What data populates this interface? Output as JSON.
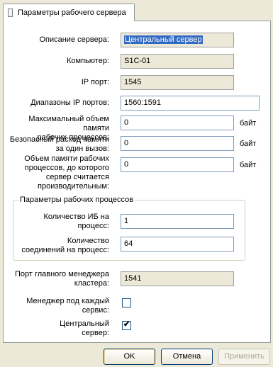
{
  "tab": {
    "label": "Параметры рабочего сервера"
  },
  "fields": {
    "description": {
      "label": "Описание сервера:",
      "value": "Центральный сервер"
    },
    "computer": {
      "label": "Компьютер:",
      "value": "S1C-01"
    },
    "ip_port": {
      "label": "IP порт:",
      "value": "1545"
    },
    "ip_ranges": {
      "label": "Диапазоны IP портов:",
      "value": "1560:1591"
    },
    "max_memory": {
      "label_1": "Максимальный объем памяти",
      "label_2": "рабочих процессов:",
      "value": "0",
      "unit": "байт"
    },
    "safe_memory": {
      "label_1": "Безопасный расход памяти",
      "label_2": "за один вызов:",
      "value": "0",
      "unit": "байт"
    },
    "memory_threshold": {
      "label_1": "Объем памяти рабочих",
      "label_2": "процессов, до которого",
      "label_3": "сервер считается",
      "label_4": "производительным:",
      "value": "0",
      "unit": "байт"
    }
  },
  "process_group": {
    "title": "Параметры рабочих процессов",
    "ib_per_process": {
      "label_1": "Количество ИБ на",
      "label_2": "процесс:",
      "value": "1"
    },
    "connections_per_process": {
      "label_1": "Количество",
      "label_2": "соединений на процесс:",
      "value": "64"
    }
  },
  "cluster_port": {
    "label_1": "Порт главного менеджера",
    "label_2": "кластера:",
    "value": "1541"
  },
  "manager_per_service": {
    "label_1": "Менеджер под каждый",
    "label_2": "сервис:",
    "checked": false
  },
  "central_server": {
    "label_1": "Центральный",
    "label_2": "сервер:",
    "checked": true,
    "check_glyph": "✔"
  },
  "buttons": {
    "ok": "OK",
    "cancel": "Отмена",
    "apply": "Применить"
  }
}
